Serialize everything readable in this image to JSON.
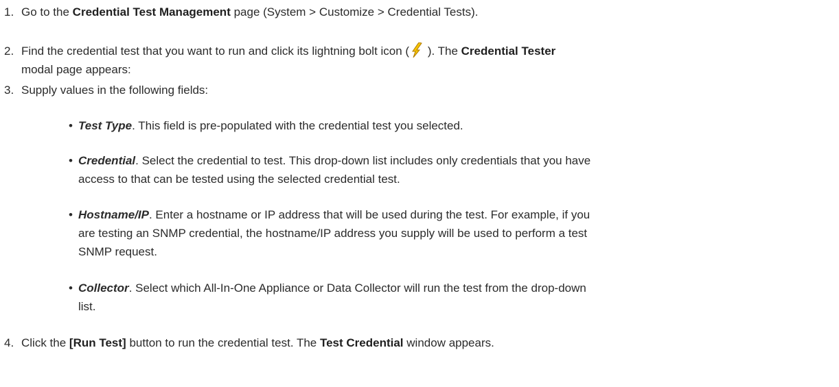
{
  "steps": [
    {
      "number": "1.",
      "pre": "Go to the ",
      "bold": "Credential Test Management",
      "post": " page (System > Customize > Credential Tests)."
    },
    {
      "number": "2.",
      "line1_pre": "Find the credential test that you want to run and click its lightning bolt icon (",
      "line1_mid": " ). The ",
      "line1_bold": "Credential Tester",
      "line2": "modal page appears:"
    },
    {
      "number": "3.",
      "text": "Supply values in the following fields:"
    },
    {
      "number": "4.",
      "pre": "Click the ",
      "bold1": "[Run Test]",
      "mid": " button to run the credential test. The ",
      "bold2": "Test Credential",
      "post": " window appears."
    }
  ],
  "fields": [
    {
      "name": "Test Type",
      "lines": [
        ". This field is pre-populated with the credential test you selected."
      ]
    },
    {
      "name": "Credential",
      "lines": [
        ". Select the credential to test. This drop-down list includes only credentials that you have",
        "access to that can be tested using the selected credential test."
      ]
    },
    {
      "name": "Hostname/IP",
      "lines": [
        ". Enter a hostname or IP address that will be used during the test. For example, if you",
        "are testing an SNMP credential, the hostname/IP address you supply will be used to perform a test",
        "SNMP request."
      ]
    },
    {
      "name": "Collector",
      "lines": [
        ". Select which All-In-One Appliance or Data Collector will run the test from the drop-down",
        "list."
      ]
    }
  ],
  "bullet_char": "•",
  "icons": {
    "lightning": "lightning-bolt-icon"
  },
  "colors": {
    "text": "#2b2b2b",
    "bolt_yellow": "#f5c400",
    "bolt_dark": "#b07a00"
  }
}
